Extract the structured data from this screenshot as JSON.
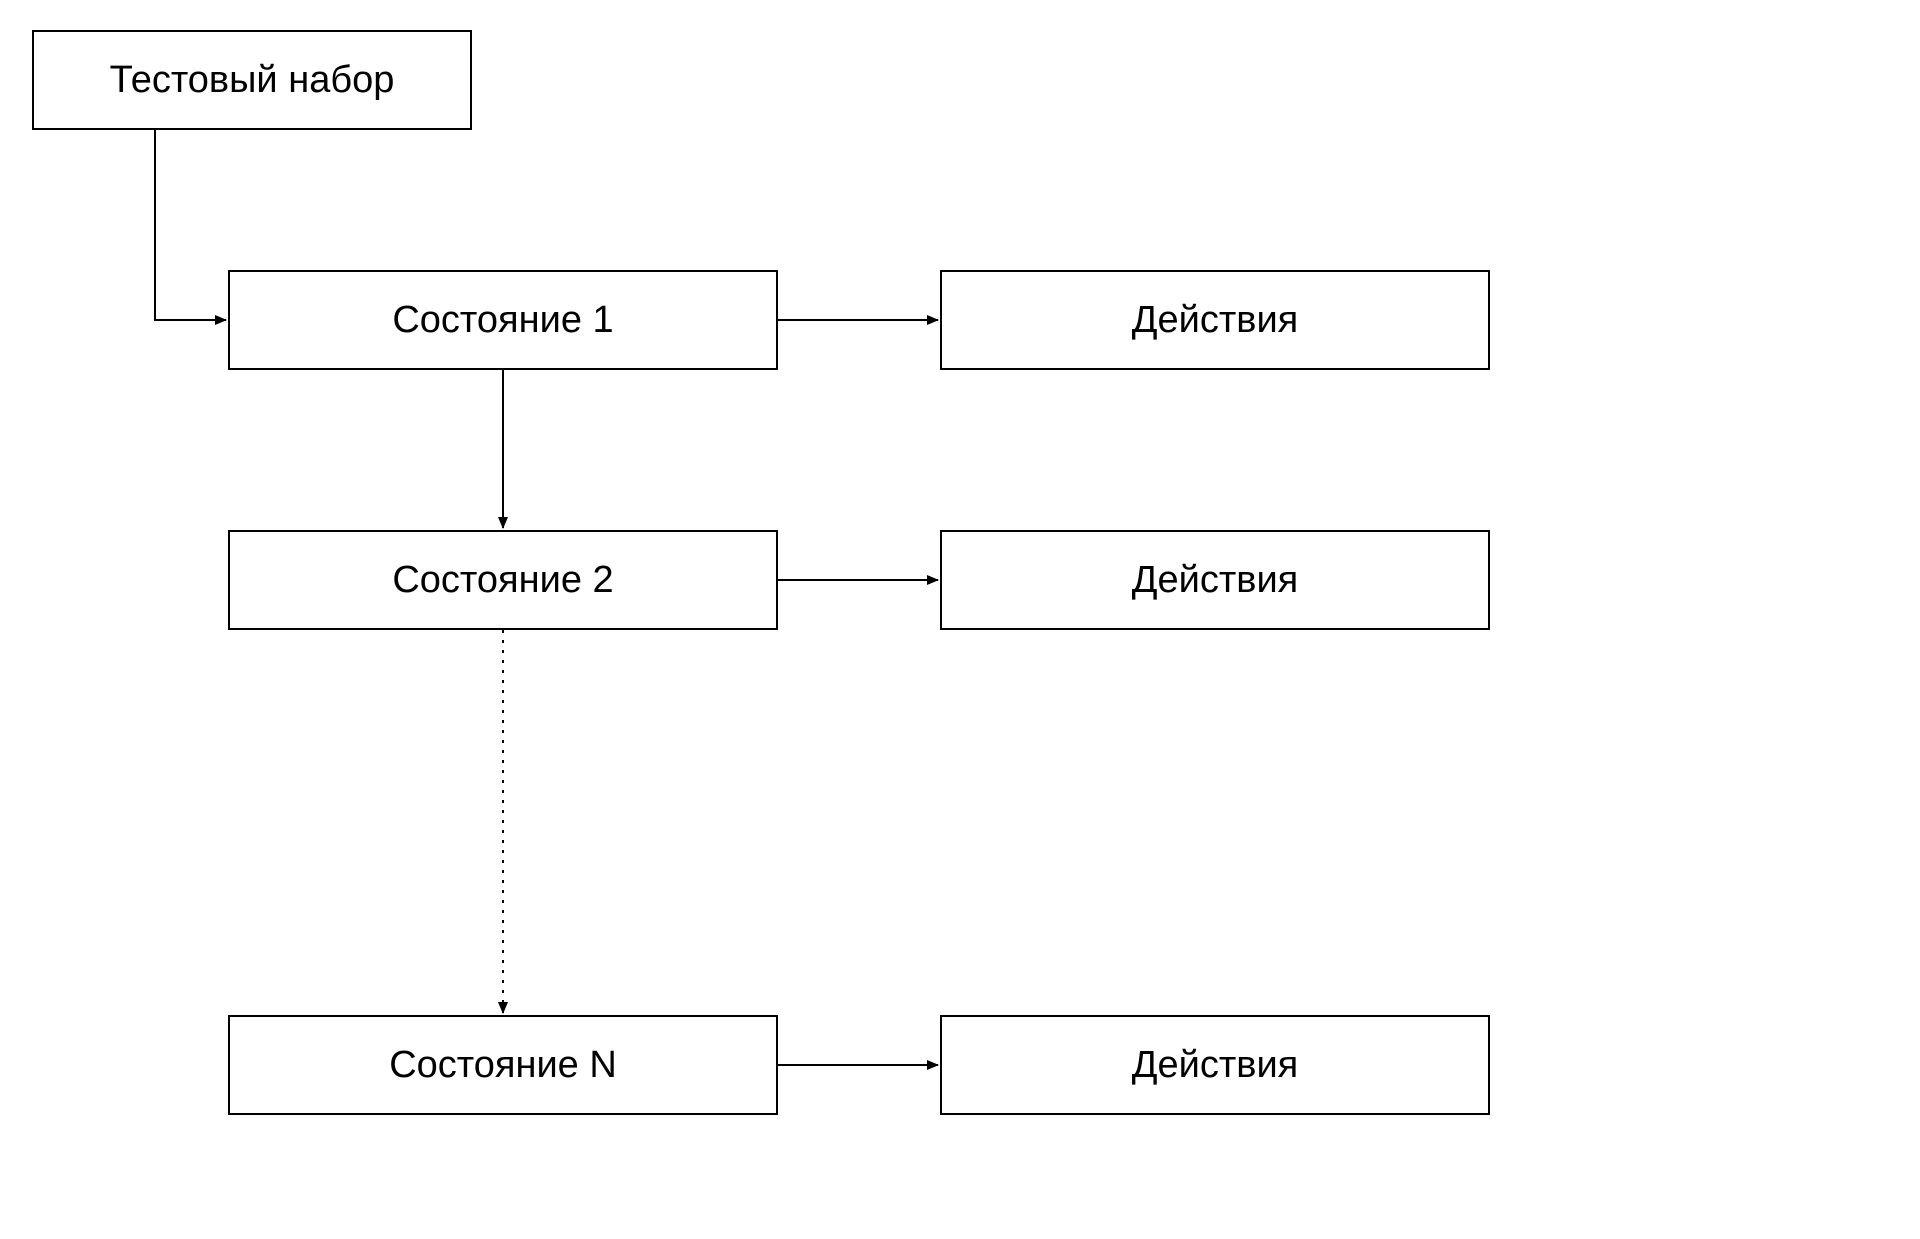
{
  "nodes": {
    "test_set": "Тестовый набор",
    "state_1": "Состояние 1",
    "state_2": "Состояние 2",
    "state_n": "Состояние N",
    "actions_1": "Действия",
    "actions_2": "Действия",
    "actions_n": "Действия"
  },
  "edges": [
    {
      "from": "test_set",
      "to": "state_1",
      "style": "elbow"
    },
    {
      "from": "state_1",
      "to": "state_2",
      "style": "solid"
    },
    {
      "from": "state_2",
      "to": "state_n",
      "style": "dotted"
    },
    {
      "from": "state_1",
      "to": "actions_1",
      "style": "solid"
    },
    {
      "from": "state_2",
      "to": "actions_2",
      "style": "solid"
    },
    {
      "from": "state_n",
      "to": "actions_n",
      "style": "solid"
    }
  ]
}
